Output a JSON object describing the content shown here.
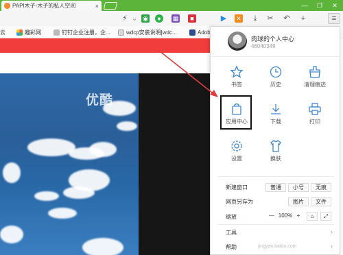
{
  "tab": {
    "title": "PAPI木子-木子的私人空间",
    "close": "×"
  },
  "window": {
    "minimize": "—",
    "restore": "❐",
    "close": "✕"
  },
  "bookmarks": [
    "云",
    "趣彩网",
    "钉钉企业注册，企...",
    "wdcp安装说明|wdc...",
    "Adob"
  ],
  "video": {
    "logo": "优酷"
  },
  "menu": {
    "username": "肉球的个人中心",
    "user_id": "46040349",
    "grid": [
      {
        "label": "书签",
        "icon": "star-icon"
      },
      {
        "label": "历史",
        "icon": "clock-icon"
      },
      {
        "label": "清理痕迹",
        "icon": "broom-icon"
      },
      {
        "label": "应用中心",
        "icon": "bag-icon"
      },
      {
        "label": "下载",
        "icon": "download-icon"
      },
      {
        "label": "打印",
        "icon": "printer-icon"
      },
      {
        "label": "设置",
        "icon": "gear-icon"
      },
      {
        "label": "换肤",
        "icon": "shirt-icon"
      }
    ],
    "new_window": {
      "label": "新建窗口",
      "options": [
        "普通",
        "小号",
        "无痕"
      ]
    },
    "save_as": {
      "label": "网页另存为",
      "options": [
        "图片",
        "文件"
      ]
    },
    "zoom": {
      "label": "缩放",
      "minus": "—",
      "value": "100%",
      "plus": "+"
    },
    "tools": {
      "label": "工具"
    },
    "help": {
      "label": "帮助"
    }
  },
  "colors": {
    "tab_bar": "#5cb53a",
    "red_bar": "#f23d3d",
    "arrow": "#e23b3b",
    "sky": "#2f69a8"
  },
  "watermark": "jingyan.baidu.com"
}
